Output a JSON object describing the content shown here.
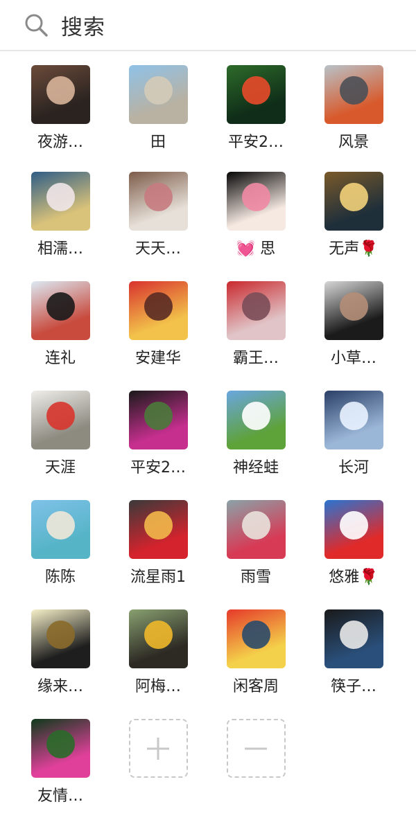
{
  "search": {
    "label": "搜索",
    "icon": "search-icon"
  },
  "members": [
    {
      "name": "夜游…",
      "avatar": {
        "icon": "headphones-man-avatar",
        "colors": [
          "#6b4b3a",
          "#2a2320",
          "#d8b49a"
        ]
      }
    },
    {
      "name": "田",
      "avatar": {
        "icon": "gate-scene-avatar",
        "colors": [
          "#8fc2e8",
          "#b9b1a1",
          "#d4cbb8"
        ]
      }
    },
    {
      "name": "平安2…",
      "avatar": {
        "icon": "koi-fish-avatar",
        "colors": [
          "#2d6b2a",
          "#0f2d18",
          "#e84a2a"
        ]
      }
    },
    {
      "name": "风景",
      "avatar": {
        "icon": "workers-photo-avatar",
        "colors": [
          "#b8c2c8",
          "#d85a2c",
          "#4b5056"
        ]
      }
    },
    {
      "name": "相濡…",
      "avatar": {
        "icon": "girl-flowers-avatar",
        "colors": [
          "#2f5d86",
          "#d9c27a",
          "#f0e6e8"
        ]
      }
    },
    {
      "name": "天天…",
      "avatar": {
        "icon": "white-flowers-avatar",
        "colors": [
          "#7d5c4a",
          "#e6e0d8",
          "#c77b80"
        ]
      }
    },
    {
      "name": "💓 思",
      "avatar": {
        "icon": "moon-night-avatar",
        "colors": [
          "#060606",
          "#f6e9e2",
          "#ef8aa4"
        ]
      }
    },
    {
      "name": "无声🌹",
      "avatar": {
        "icon": "sunset-text-avatar",
        "colors": [
          "#7a5a2a",
          "#1f2f3a",
          "#f2d27a"
        ]
      }
    },
    {
      "name": "连礼",
      "avatar": {
        "icon": "man-beach-avatar",
        "colors": [
          "#dce9f3",
          "#c84b3e",
          "#1a1a1a"
        ]
      }
    },
    {
      "name": "安建华",
      "avatar": {
        "icon": "woman-red-avatar",
        "colors": [
          "#d8322e",
          "#f2c24a",
          "#5a2b24"
        ]
      }
    },
    {
      "name": "霸王…",
      "avatar": {
        "icon": "woman-lanterns-avatar",
        "colors": [
          "#c9292e",
          "#e0c4c7",
          "#7a4d58"
        ]
      }
    },
    {
      "name": "小草…",
      "avatar": {
        "icon": "man-portrait-avatar",
        "colors": [
          "#d7d7d7",
          "#1b1b1b",
          "#b58e78"
        ]
      }
    },
    {
      "name": "天涯",
      "avatar": {
        "icon": "calligraphy-flag-avatar",
        "colors": [
          "#efeeea",
          "#8d8a80",
          "#d8352c"
        ]
      }
    },
    {
      "name": "平安2…",
      "avatar": {
        "icon": "pink-flowers-avatar",
        "colors": [
          "#1a1a1a",
          "#c72f8f",
          "#4a7a3a"
        ]
      }
    },
    {
      "name": "神经蛙",
      "avatar": {
        "icon": "tree-meadow-avatar",
        "colors": [
          "#6aa6e0",
          "#5ea23a",
          "#ffffff"
        ]
      }
    },
    {
      "name": "长河",
      "avatar": {
        "icon": "moon-figure-avatar",
        "colors": [
          "#2a3f66",
          "#9bb7d8",
          "#e9f2ff"
        ]
      }
    },
    {
      "name": "陈陈",
      "avatar": {
        "icon": "sea-beach-avatar",
        "colors": [
          "#7fc1e9",
          "#55b4c6",
          "#efe8d8"
        ]
      }
    },
    {
      "name": "流星雨1",
      "avatar": {
        "icon": "child-red-avatar",
        "colors": [
          "#3a3a3a",
          "#d4232d",
          "#f2b84a"
        ]
      }
    },
    {
      "name": "雨雪",
      "avatar": {
        "icon": "love-hands-avatar",
        "colors": [
          "#8aa3a8",
          "#d73a55",
          "#e9e2dc"
        ]
      }
    },
    {
      "name": "悠雅🌹",
      "avatar": {
        "icon": "apple-hands-avatar",
        "colors": [
          "#2a74d1",
          "#e02a2a",
          "#ffffff"
        ]
      }
    },
    {
      "name": "缘来…",
      "avatar": {
        "icon": "calligraphy-text-avatar",
        "colors": [
          "#f6f0c8",
          "#1e1e1e",
          "#8a6a2a"
        ]
      }
    },
    {
      "name": "阿梅…",
      "avatar": {
        "icon": "cat-fish-avatar",
        "colors": [
          "#88a070",
          "#2d2a24",
          "#f0b82a"
        ]
      }
    },
    {
      "name": "闲客周",
      "avatar": {
        "icon": "kungfu-flag-avatar",
        "colors": [
          "#e53a2a",
          "#f4d14a",
          "#2a4a6a"
        ]
      }
    },
    {
      "name": "筷子…",
      "avatar": {
        "icon": "man-suit-avatar",
        "colors": [
          "#1a1a1a",
          "#2a4f7a",
          "#e8e8e8"
        ]
      }
    },
    {
      "name": "友情…",
      "avatar": {
        "icon": "lotus-avatar",
        "colors": [
          "#0e3a1a",
          "#e0409a",
          "#2a6a2a"
        ]
      }
    }
  ],
  "actions": {
    "add": {
      "icon": "plus-icon",
      "color": "#c8c8c8"
    },
    "remove": {
      "icon": "minus-icon",
      "color": "#c8c8c8"
    }
  }
}
